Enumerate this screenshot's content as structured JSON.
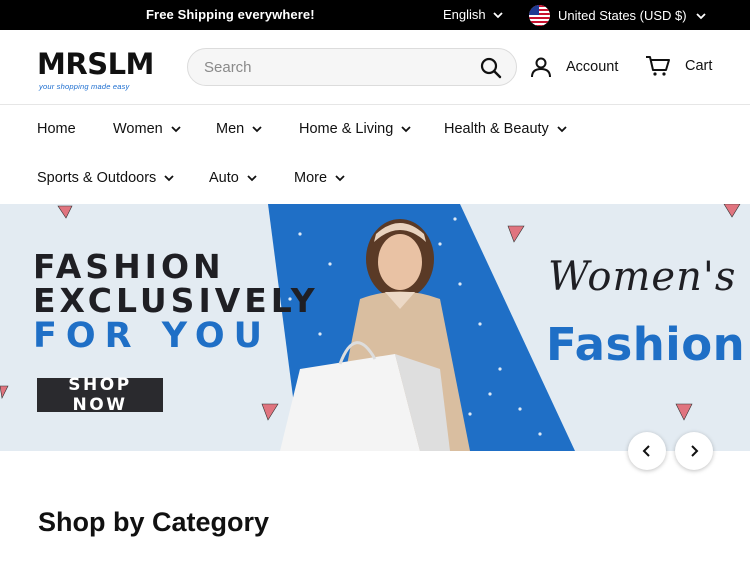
{
  "topbar": {
    "promo": "Free Shipping everywhere!",
    "language": "English",
    "currency": "United States (USD $)"
  },
  "header": {
    "logo_text": "MRSLM",
    "logo_tagline": "your shopping made easy",
    "search_placeholder": "Search",
    "account_label": "Account",
    "cart_label": "Cart"
  },
  "nav": {
    "items": [
      {
        "label": "Home",
        "dropdown": false
      },
      {
        "label": "Women",
        "dropdown": true
      },
      {
        "label": "Men",
        "dropdown": true
      },
      {
        "label": "Home & Living",
        "dropdown": true
      },
      {
        "label": "Health & Beauty",
        "dropdown": true
      },
      {
        "label": "Sports & Outdoors",
        "dropdown": true
      },
      {
        "label": "Auto",
        "dropdown": true
      },
      {
        "label": "More",
        "dropdown": true
      }
    ]
  },
  "hero": {
    "line1": "FASHION",
    "line2": "EXCLUSIVELY",
    "line3": "FOR YOU",
    "cta": "SHOP NOW",
    "script_text": "Women's",
    "headline": "Fashion"
  },
  "sections": {
    "category_title": "Shop by Category"
  },
  "colors": {
    "brand_blue": "#1f6fc6",
    "topbar_bg": "#000000",
    "hero_bg": "#e3ebf2"
  },
  "icons": {
    "search": "search-icon",
    "account": "user-icon",
    "cart": "cart-icon",
    "prev": "chevron-left-icon",
    "next": "chevron-right-icon"
  }
}
